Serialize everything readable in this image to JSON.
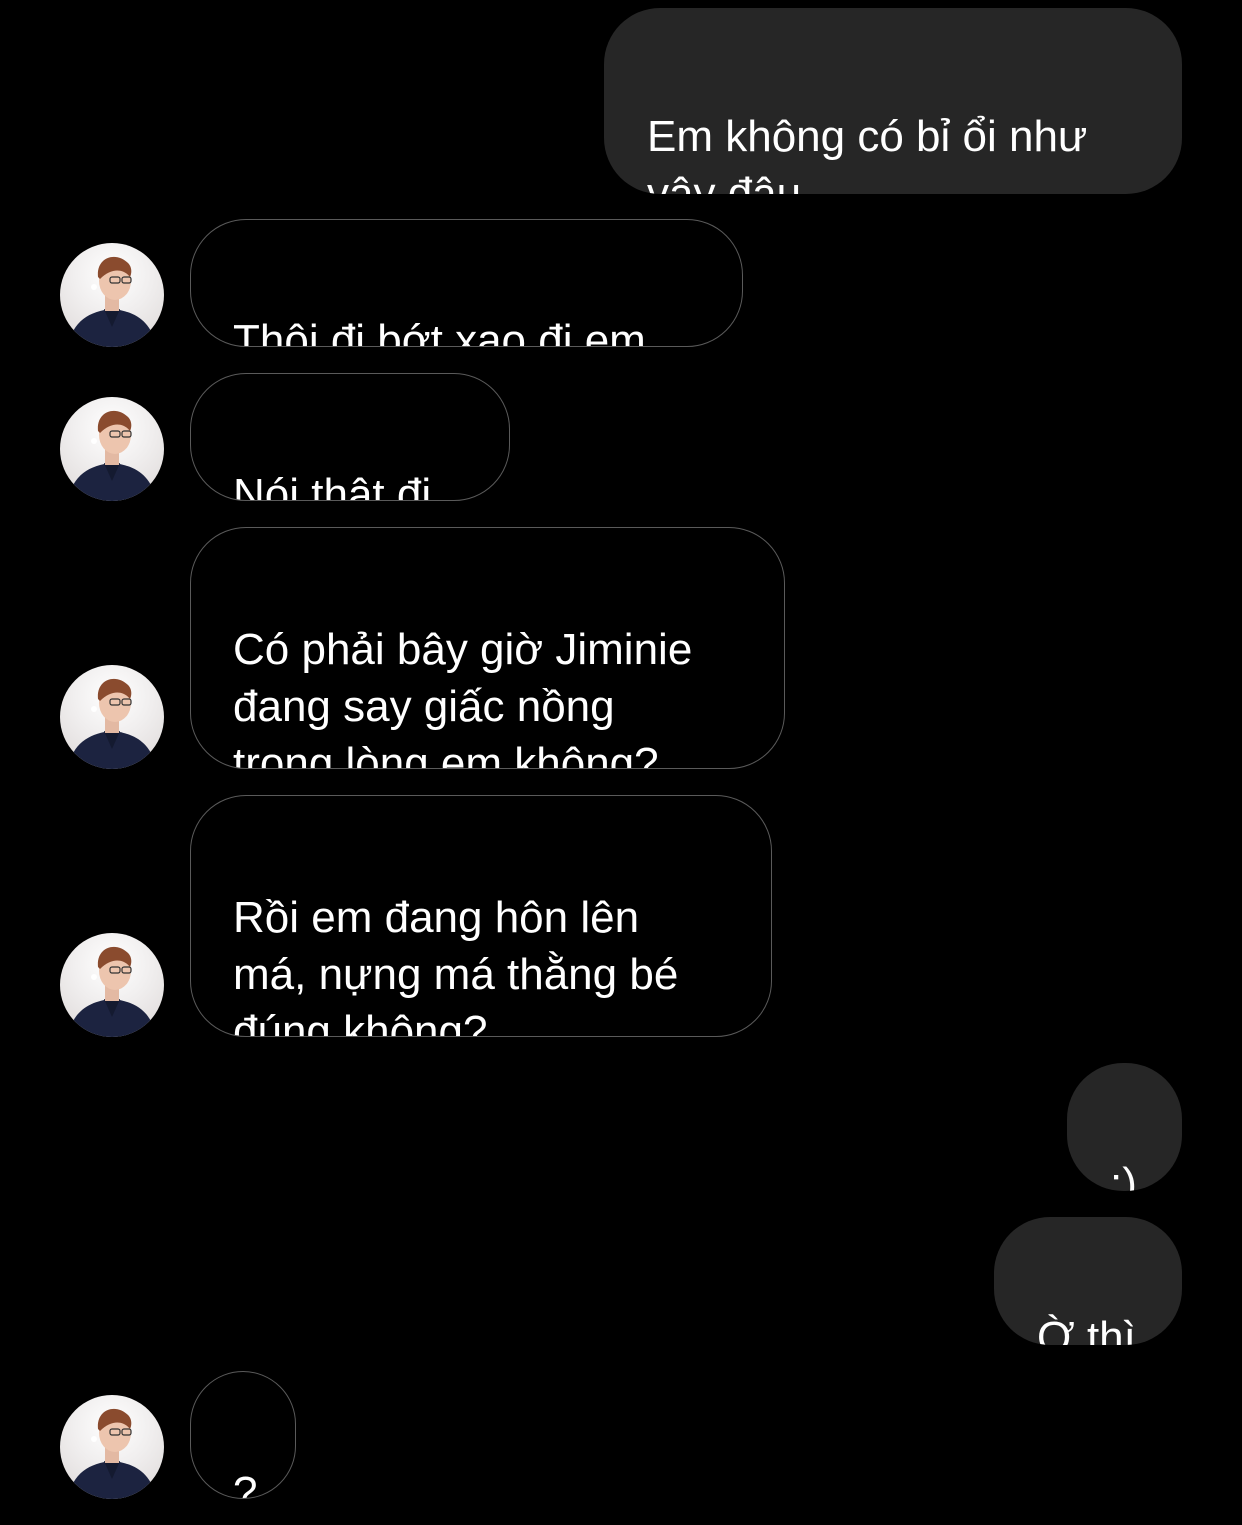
{
  "conversation": {
    "messages": [
      {
        "sender": "me",
        "text": "Em không có bỉ ổi như\nvậy đâu"
      },
      {
        "sender": "other",
        "text": "Thôi đi bớt xạo đi em",
        "avatar": "avatar-photo"
      },
      {
        "sender": "other",
        "text": "Nói thật đi",
        "avatar": "avatar-photo"
      },
      {
        "sender": "other",
        "text": "Có phải bây giờ Jiminie\nđang say giấc nồng\ntrong lòng em không?",
        "avatar": "avatar-photo"
      },
      {
        "sender": "other",
        "text": "Rồi em đang hôn lên\nmá, nựng má thằng bé\nđúng không?",
        "avatar": "avatar-photo"
      },
      {
        "sender": "me",
        "text": ":)"
      },
      {
        "sender": "me",
        "text": "Ờ thì"
      },
      {
        "sender": "other",
        "text": "?",
        "avatar": "avatar-photo"
      }
    ]
  },
  "colors": {
    "background": "#000000",
    "sent_bubble": "#262626",
    "received_border": "#5a5a5a",
    "text": "#ffffff"
  }
}
